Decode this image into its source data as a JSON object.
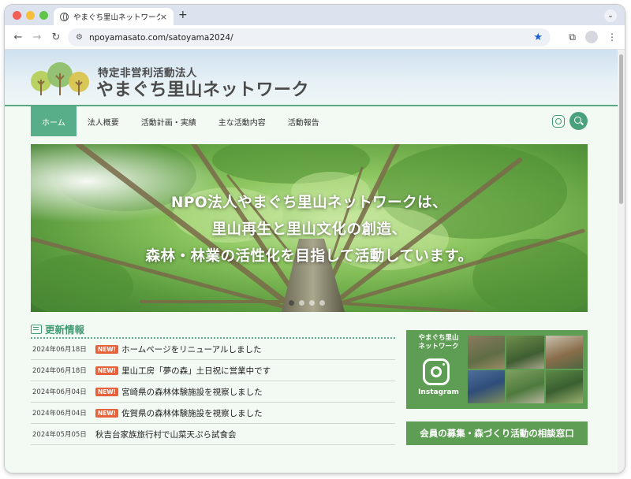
{
  "browser": {
    "tab_title": "やまぐち里山ネットワーク",
    "tab_close": "×",
    "new_tab": "+",
    "tab_menu": "⌄",
    "back": "←",
    "forward": "→",
    "reload": "↻",
    "url": "npoyamasato.com/satoyama2024/",
    "bookmark_star": "★",
    "extensions": "⧉",
    "menu": "⋮"
  },
  "header": {
    "org_type": "特定非営利活動法人",
    "org_name": "やまぐち里山ネットワーク"
  },
  "nav": {
    "items": [
      "ホーム",
      "法人概要",
      "活動計画・実績",
      "主な活動内容",
      "活動報告"
    ],
    "active_index": 0
  },
  "hero": {
    "lines": [
      "NPO法人やまぐち里山ネットワークは、",
      "里山再生と里山文化の創造、",
      "森林・林業の活性化を目指して活動しています。"
    ],
    "slide_count": 4,
    "active_slide": 1
  },
  "news": {
    "title": "更新情報",
    "badge": "NEW!",
    "items": [
      {
        "date": "2024年06月18日",
        "new": true,
        "text": "ホームページをリニューアルしました"
      },
      {
        "date": "2024年06月18日",
        "new": true,
        "text": "里山工房「夢の森」土日祝に営業中です"
      },
      {
        "date": "2024年06月04日",
        "new": true,
        "text": "宮崎県の森林体験施設を視察しました"
      },
      {
        "date": "2024年06月04日",
        "new": true,
        "text": "佐賀県の森林体験施設を視察しました"
      },
      {
        "date": "2024年05月05日",
        "new": false,
        "text": "秋吉台家族旅行村で山菜天ぷら試食会"
      }
    ]
  },
  "sidebar": {
    "instagram_name_line1": "やまぐち里山",
    "instagram_name_line2": "ネットワーク",
    "instagram_caption": "Instagram",
    "consult_button": "会員の募集・森づくり活動の相談窓口"
  },
  "colors": {
    "accent": "#57ae88",
    "dark_green": "#5e9e54",
    "new_badge": "#e8613a"
  }
}
